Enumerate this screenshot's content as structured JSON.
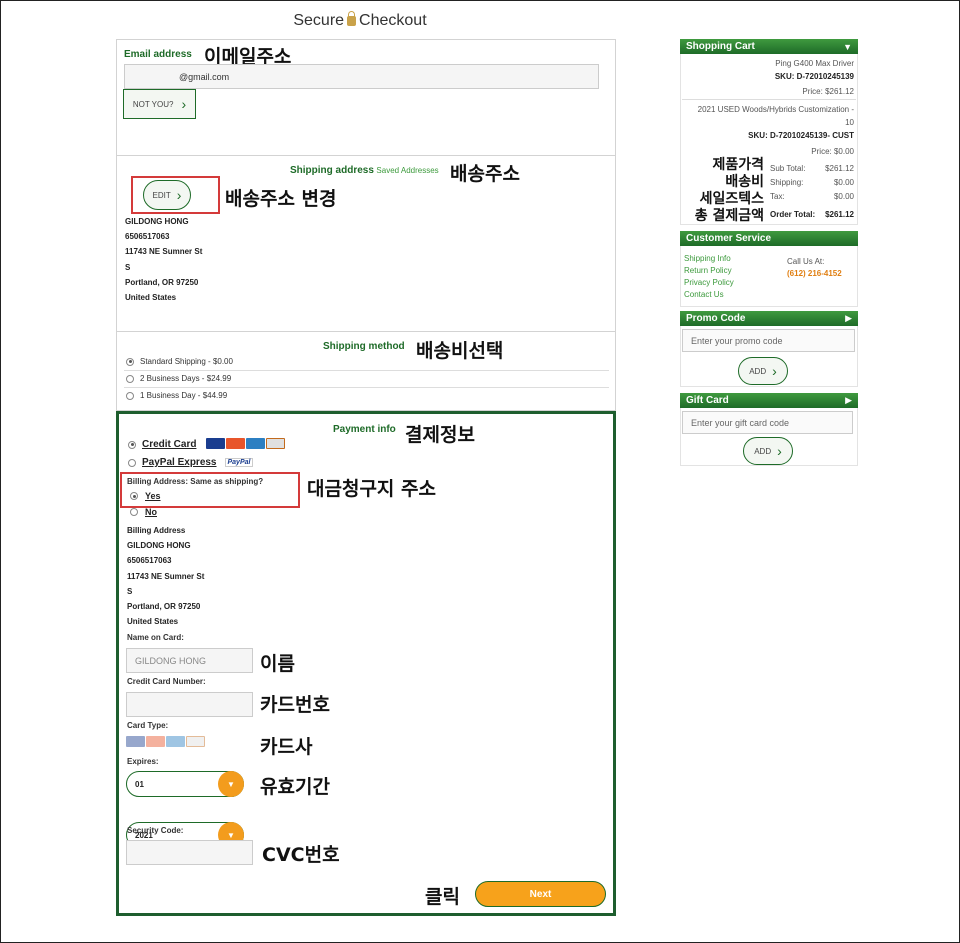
{
  "header": {
    "title_left": "Secure",
    "title_right": "Checkout"
  },
  "email": {
    "heading": "Email address",
    "value": "@gmail.com",
    "not_you": "NOT YOU?",
    "anno": "이메일주소"
  },
  "shipping": {
    "heading": "Shipping address",
    "saved": "Saved Addresses",
    "anno": "배송주소",
    "edit": "EDIT",
    "edit_anno": "배송주소 변경",
    "address": [
      "GILDONG HONG",
      "6506517063",
      "11743 NE Sumner St",
      "S",
      "Portland, OR 97250",
      "United States"
    ]
  },
  "method": {
    "heading": "Shipping method",
    "anno": "배송비선택",
    "options": [
      {
        "label": "Standard Shipping - $0.00",
        "selected": true
      },
      {
        "label": "2 Business Days - $24.99",
        "selected": false
      },
      {
        "label": "1 Business Day - $44.99",
        "selected": false
      }
    ]
  },
  "payment": {
    "heading": "Payment info",
    "anno": "결제정보",
    "credit_card": "Credit Card",
    "paypal": "PayPal Express",
    "paypal_logo": "PayPal",
    "billing_question": "Billing Address: Same as shipping?",
    "billing_anno": "대금청구지 주소",
    "yes": "Yes",
    "no": "No",
    "billing_heading": "Billing Address",
    "billing_address": [
      "GILDONG HONG",
      "6506517063",
      "11743 NE Sumner St",
      "S",
      "Portland, OR 97250",
      "United States"
    ],
    "name_label": "Name on Card:",
    "name_value": "GILDONG HONG",
    "name_anno": "이름",
    "ccn_label": "Credit Card Number:",
    "ccn_anno": "카드번호",
    "type_label": "Card Type:",
    "type_anno": "카드사",
    "expires_label": "Expires:",
    "expires_anno": "유효기간",
    "month": "01",
    "year": "2021",
    "security_label": "Security Code:",
    "security_anno": "CVC번호",
    "next": "Next",
    "next_anno": "클릭"
  },
  "cart": {
    "heading": "Shopping Cart",
    "item1_name": "Ping G400 Max Driver",
    "item1_sku": "SKU: D-72010245139",
    "item1_price": "Price: $261.12",
    "item2_name": "2021 USED Woods/Hybrids Customization -",
    "item2_name2": "10",
    "item2_sku": "SKU: D-72010245139- CUST",
    "item2_price": "Price: $0.00",
    "sub_label": "Sub Total:",
    "sub_value": "$261.12",
    "ship_label": "Shipping:",
    "ship_value": "$0.00",
    "tax_label": "Tax:",
    "tax_value": "$0.00",
    "order_label": "Order Total:",
    "order_value": "$261.12",
    "anno_lines": [
      "제품가격",
      "배송비",
      "세일즈텍스",
      "총 결제금액"
    ]
  },
  "service": {
    "heading": "Customer Service",
    "links": [
      "Shipping Info",
      "Return Policy",
      "Privacy Policy",
      "Contact Us"
    ],
    "call_label": "Call Us At:",
    "phone": "(612) 216-4152"
  },
  "promo": {
    "heading": "Promo Code",
    "placeholder": "Enter your promo code",
    "add": "ADD"
  },
  "gift": {
    "heading": "Gift Card",
    "placeholder": "Enter your gift card code",
    "add": "ADD"
  },
  "colors": {
    "brand_green": "#1e6b28",
    "accent_orange": "#f39c1d",
    "annotation_red": "#d43a3a"
  },
  "icons": [
    "lock-icon",
    "chevron-right-icon",
    "chevron-down-icon",
    "triangle-right-icon",
    "visa-icon",
    "mastercard-icon",
    "amex-icon",
    "discover-icon",
    "paypal-icon"
  ]
}
